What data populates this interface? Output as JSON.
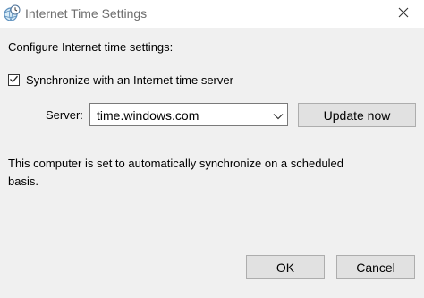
{
  "window": {
    "title": "Internet Time Settings"
  },
  "dialog": {
    "heading": "Configure Internet time settings:",
    "sync_checkbox": {
      "label": "Synchronize with an Internet time server",
      "checked": true
    },
    "server": {
      "label": "Server:",
      "value": "time.windows.com"
    },
    "update_button": "Update now",
    "status_line1": "This computer is set to automatically synchronize on a scheduled",
    "status_line2": "basis."
  },
  "footer": {
    "ok_label": "OK",
    "cancel_label": "Cancel"
  },
  "icons": {
    "app": "clock-globe-icon",
    "close": "close-icon",
    "dropdown": "chevron-down-icon",
    "check": "checkmark-icon"
  },
  "colors": {
    "window_bg": "#f0f0f0",
    "titlebar_bg": "#ffffff",
    "title_text": "#6d6d6d",
    "button_bg": "#e1e1e1",
    "button_border": "#adadad"
  }
}
